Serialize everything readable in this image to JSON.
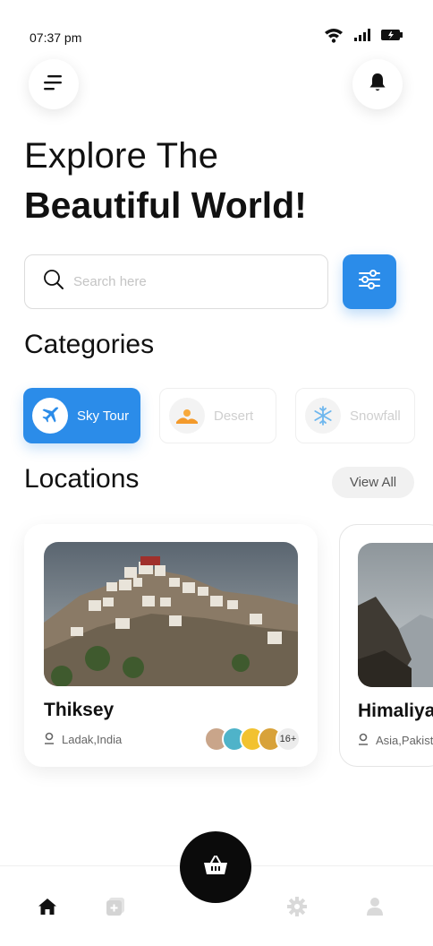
{
  "status": {
    "time": "07:37 pm"
  },
  "header": {
    "line1": "Explore The",
    "line2": "Beautiful World!"
  },
  "search": {
    "placeholder": "Search here",
    "value": ""
  },
  "categories": {
    "title": "Categories",
    "items": [
      {
        "label": "Sky Tour",
        "icon": "airplane-icon",
        "active": true
      },
      {
        "label": "Desert",
        "icon": "desert-icon",
        "active": false
      },
      {
        "label": "Snowfall",
        "icon": "snowflake-icon",
        "active": false
      }
    ]
  },
  "locations": {
    "title": "Locations",
    "view_all": "View All",
    "cards": [
      {
        "name": "Thiksey",
        "place": "Ladak,India",
        "visitors_more": "16+"
      },
      {
        "name": "Himaliya",
        "place": "Asia,Pakistan"
      }
    ]
  },
  "colors": {
    "accent": "#2b8ce9",
    "dark": "#0b0b0b"
  },
  "nav": {
    "items": [
      "home-icon",
      "add-icon",
      "settings-icon",
      "profile-icon"
    ],
    "center": "basket-icon"
  }
}
